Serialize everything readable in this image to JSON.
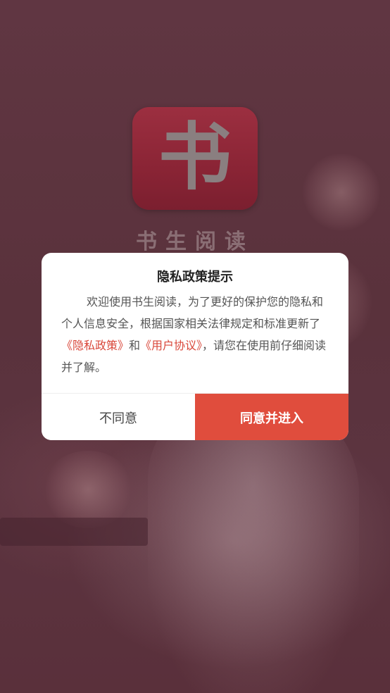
{
  "app": {
    "logo_glyph": "书",
    "name": "书生阅读"
  },
  "dialog": {
    "title": "隐私政策提示",
    "body_intro": "欢迎使用书生阅读，为了更好的保护您的隐私和个人信息安全，根据国家相关法律规定和标准更新了",
    "privacy_link": "《隐私政策》",
    "connector": "和",
    "agreement_link": "《用户协议》",
    "body_outro": "，请您在使用前仔细阅读并了解。",
    "decline_label": "不同意",
    "accept_label": "同意并进入"
  },
  "colors": {
    "accent": "#e04d3d",
    "link": "#d9473a",
    "background": "#5e3540"
  }
}
